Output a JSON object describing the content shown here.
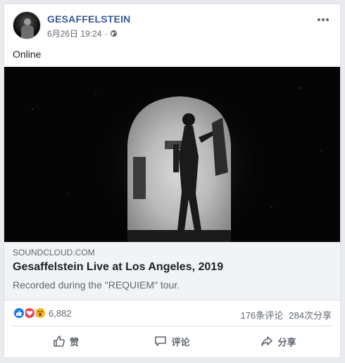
{
  "post": {
    "page_name": "GESAFFELSTEIN",
    "timestamp": "6月26日 19:24",
    "separator": "·",
    "text": "Online",
    "privacy_icon": "globe-icon",
    "more_icon": "more-dots-icon"
  },
  "link_preview": {
    "domain": "SOUNDCLOUD.COM",
    "title": "Gesaffelstein Live at Los Angeles, 2019",
    "description": "Recorded during the \"REQUIEM\" tour."
  },
  "stats": {
    "reaction_count": "6,882",
    "comments": "176条评论",
    "shares": "284次分享",
    "reaction_types": [
      "like",
      "love",
      "wow"
    ]
  },
  "actions": {
    "like_label": "赞",
    "comment_label": "评论",
    "share_label": "分享"
  },
  "colors": {
    "link_blue": "#385898",
    "like_blue": "#1877f2",
    "love_red": "#f33e58",
    "wow_yellow": "#f7b125"
  }
}
